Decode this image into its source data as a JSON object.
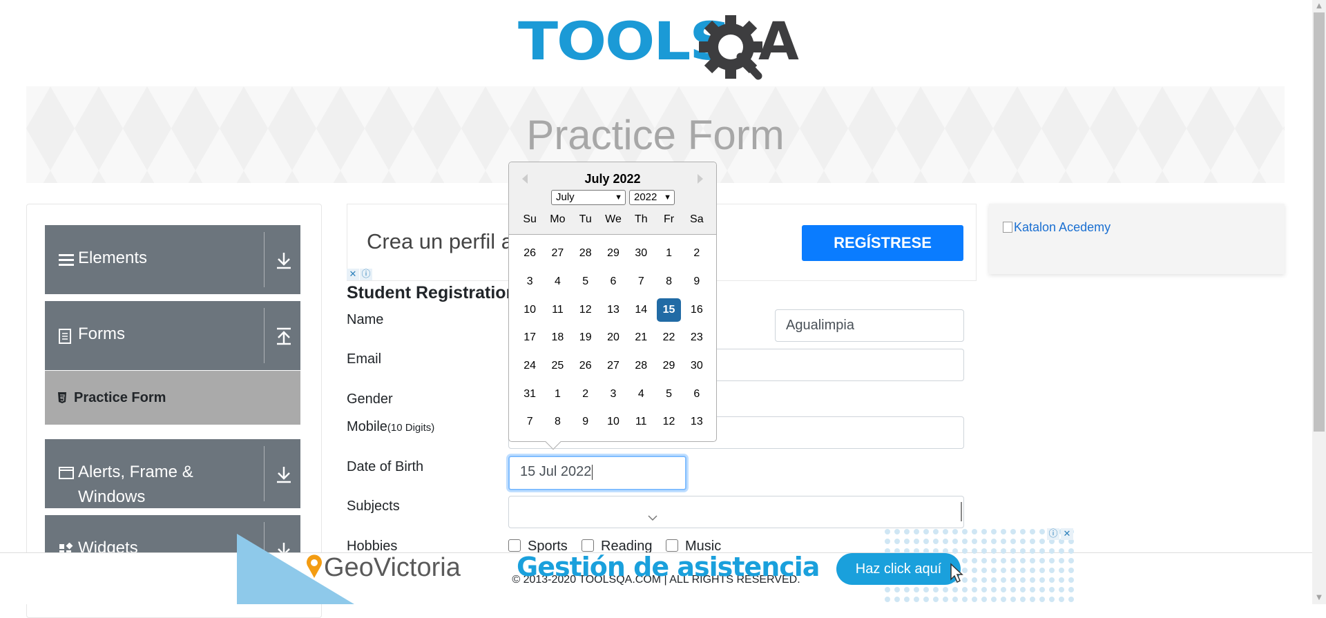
{
  "header": {
    "logo_text": "TOOLS",
    "logo_suffix": "A",
    "banner_title": "Practice Form"
  },
  "sidebar": {
    "groups": [
      {
        "label": "Elements",
        "icon": "menu-icon",
        "arrow": "download-icon"
      },
      {
        "label": "Forms",
        "icon": "document-icon",
        "arrow": "upload-icon"
      },
      {
        "label": "Alerts, Frame & Windows",
        "label_line1": "Alerts, Frame &",
        "label_line2": "Windows",
        "icon": "window-icon",
        "arrow": "download-icon"
      },
      {
        "label": "Widgets",
        "icon": "widgets-icon",
        "arrow": "download-icon"
      }
    ],
    "active_item": {
      "label": "Practice Form",
      "icon": "html5-icon"
    }
  },
  "ad_top": {
    "text": "Crea un perfil a",
    "button": "REGÍSTRESE",
    "badge_close": "✕",
    "badge_info": "ⓘ"
  },
  "form": {
    "title": "Student Registration",
    "name_label": "Name",
    "last_name_value": "Agualimpia",
    "email_label": "Email",
    "gender_label": "Gender",
    "mobile_label": "Mobile",
    "mobile_hint": "(10 Digits)",
    "dob_label": "Date of Birth",
    "dob_value": "15 Jul 2022",
    "subjects_label": "Subjects",
    "hobbies_label": "Hobbies",
    "hobbies": [
      "Sports",
      "Reading",
      "Music"
    ]
  },
  "datepicker": {
    "header": "July 2022",
    "month_select": "July",
    "year_select": "2022",
    "weekdays": [
      "Su",
      "Mo",
      "Tu",
      "We",
      "Th",
      "Fr",
      "Sa"
    ],
    "weeks": [
      [
        "26",
        "27",
        "28",
        "29",
        "30",
        "1",
        "2"
      ],
      [
        "3",
        "4",
        "5",
        "6",
        "7",
        "8",
        "9"
      ],
      [
        "10",
        "11",
        "12",
        "13",
        "14",
        "15",
        "16"
      ],
      [
        "17",
        "18",
        "19",
        "20",
        "21",
        "22",
        "23"
      ],
      [
        "24",
        "25",
        "26",
        "27",
        "28",
        "29",
        "30"
      ],
      [
        "31",
        "1",
        "2",
        "3",
        "4",
        "5",
        "6"
      ],
      [
        "7",
        "8",
        "9",
        "10",
        "11",
        "12",
        "13"
      ]
    ],
    "selected_day": "15",
    "selected_color": "#216ba5"
  },
  "ad_right": {
    "alt_text": "Katalon Acedemy"
  },
  "ad_bottom": {
    "brand": "GeoVictoria",
    "headline": "Gestión de asistencia",
    "cta": "Haz click aquí"
  },
  "footer": {
    "text": "© 2013-2020 TOOLSQA.COM | ALL RIGHTS RESERVED."
  },
  "colors": {
    "sidebar_group": "#6c757d",
    "sidebar_active": "#aaaaaa",
    "brand_blue": "#1b9ad6",
    "button_blue": "#0a7cff"
  }
}
